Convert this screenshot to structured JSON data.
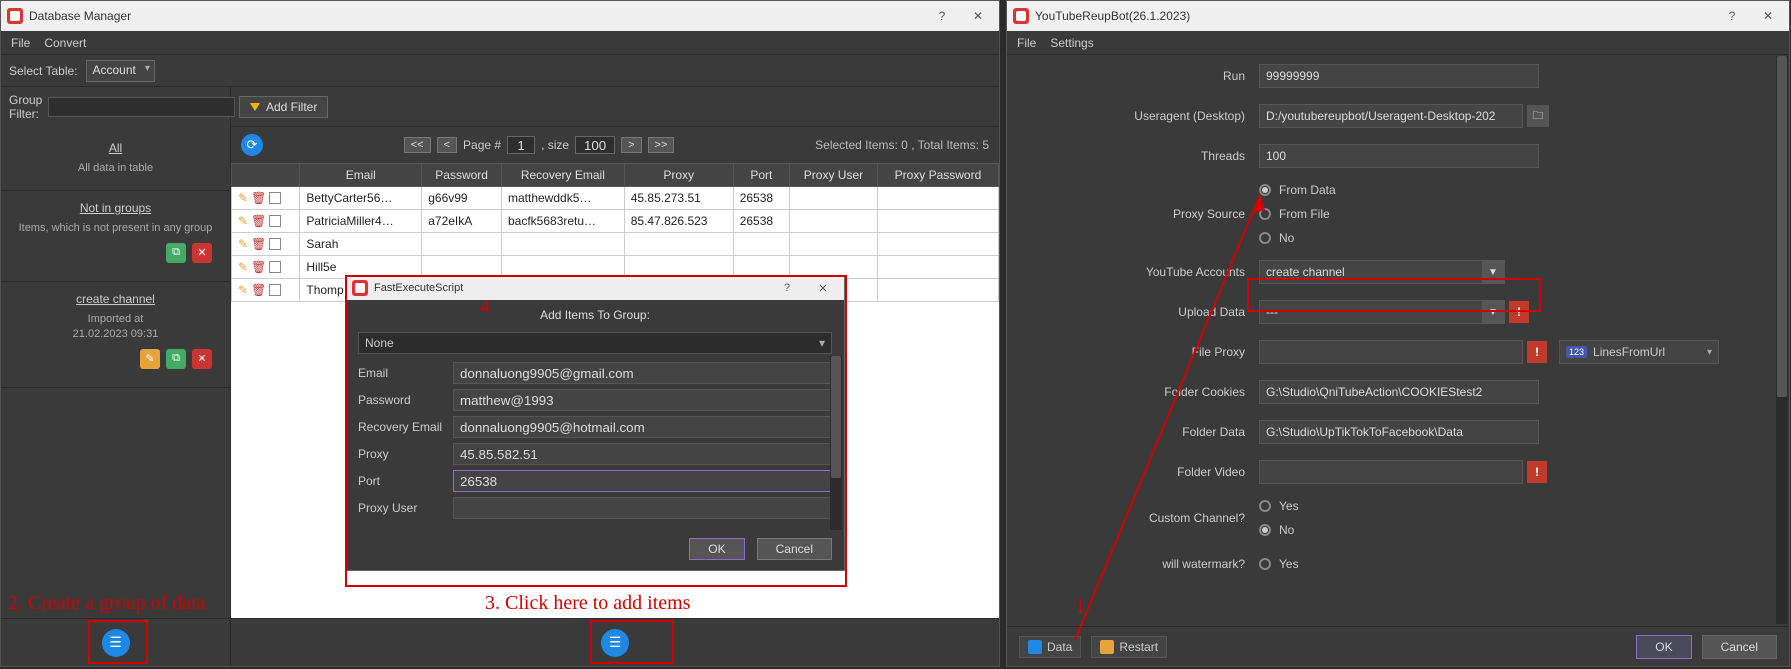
{
  "left": {
    "title": "Database Manager",
    "menu": {
      "file": "File",
      "convert": "Convert"
    },
    "select_table_label": "Select Table:",
    "select_table_value": "Account",
    "group_filter_label": "Group Filter:",
    "sidebar": {
      "all": {
        "title": "All",
        "desc": "All data in table"
      },
      "not_in_groups": {
        "title": "Not in groups",
        "desc": "Items, which is not present in any group"
      },
      "create_channel": {
        "title": "create channel",
        "line1": "Imported at",
        "line2": "21.02.2023 09:31"
      }
    },
    "add_filter": "Add Filter",
    "pager": {
      "first": "<<",
      "prev": "<",
      "page_label": "Page #",
      "page": "1",
      "size_label": ", size",
      "size": "100",
      "next": ">",
      "last": ">>",
      "status": "Selected Items:  0  , Total Items:  5"
    },
    "columns": [
      "",
      "Email",
      "Password",
      "Recovery Email",
      "Proxy",
      "Port",
      "Proxy User",
      "Proxy Password"
    ],
    "rows": [
      {
        "email": "BettyCarter56…",
        "password": "g66v99",
        "recovery": "matthewddk5…",
        "proxy": "45.85.273.51",
        "port": "26538",
        "puser": "",
        "ppass": ""
      },
      {
        "email": "PatriciaMiller4…",
        "password": "a72eIkA",
        "recovery": "bacfk5683retu…",
        "proxy": "85.47.826.523",
        "port": "26538",
        "puser": "",
        "ppass": ""
      },
      {
        "email": "Sarah",
        "password": "",
        "recovery": "",
        "proxy": "",
        "port": "",
        "puser": "",
        "ppass": ""
      },
      {
        "email": "Hill5e",
        "password": "",
        "recovery": "",
        "proxy": "",
        "port": "",
        "puser": "",
        "ppass": ""
      },
      {
        "email": "Thomp",
        "password": "",
        "recovery": "",
        "proxy": "",
        "port": "",
        "puser": "",
        "ppass": ""
      }
    ],
    "dialog": {
      "title": "FastExecuteScript",
      "heading": "Add Items To Group:",
      "combo": "None",
      "fields": {
        "email_l": "Email",
        "email_v": "donnaluong9905@gmail.com",
        "password_l": "Password",
        "password_v": "matthew@1993",
        "recovery_l": "Recovery Email",
        "recovery_v": "donnaluong9905@hotmail.com",
        "proxy_l": "Proxy",
        "proxy_v": "45.85.582.51",
        "port_l": "Port",
        "port_v": "26538",
        "puser_l": "Proxy User",
        "puser_v": ""
      },
      "ok": "OK",
      "cancel": "Cancel"
    }
  },
  "right": {
    "title": "YouTubeReupBot(26.1.2023)",
    "menu": {
      "file": "File",
      "settings": "Settings"
    },
    "labels": {
      "run": "Run",
      "useragent": "Useragent (Desktop)",
      "threads": "Threads",
      "proxy_source": "Proxy Source",
      "yt_accounts": "YouTube Accounts",
      "upload_data": "Upload Data",
      "file_proxy": "File Proxy",
      "folder_cookies": "Folder Cookies",
      "folder_data": "Folder Data",
      "folder_video": "Folder Video",
      "custom_channel": "Custom Channel?",
      "will_watermark": "will watermark?"
    },
    "values": {
      "run": "99999999",
      "useragent": "D:/youtubereupbot/Useragent-Desktop-202",
      "threads": "100",
      "yt_accounts": "create channel",
      "upload_data": "---",
      "file_proxy": "",
      "folder_cookies": "G:\\Studio\\QniTubeAction\\COOKIEStest2",
      "folder_data": "G:\\Studio\\UpTikTokToFacebook\\Data",
      "folder_video": ""
    },
    "radios": {
      "proxy": [
        "From Data",
        "From File",
        "No"
      ],
      "custom": [
        "Yes",
        "No"
      ],
      "wm": [
        "Yes"
      ]
    },
    "linesfromurl": "LinesFromUrl",
    "footer": {
      "data": "Data",
      "restart": "Restart",
      "ok": "OK",
      "cancel": "Cancel"
    }
  },
  "annotations": {
    "a1": "1",
    "a2": "2. Create a group of data",
    "a3": "3. Click here to add items",
    "a4": "4"
  }
}
